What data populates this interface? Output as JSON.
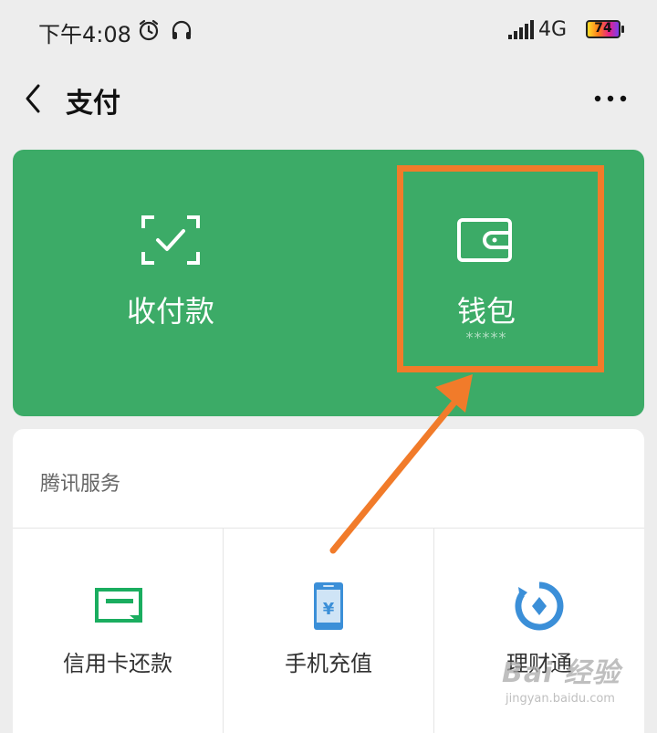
{
  "status_bar": {
    "time": "下午4:08",
    "network": "4G",
    "battery_level": "74",
    "icons": [
      "alarm-icon",
      "headset-icon",
      "signal-icon",
      "battery-icon"
    ]
  },
  "nav": {
    "title": "支付",
    "back_icon": "chevron-left-icon",
    "more_icon": "more-dots-icon"
  },
  "card": {
    "items": [
      {
        "label": "收付款",
        "icon": "scan-check-icon"
      },
      {
        "label": "钱包",
        "sub": "*****",
        "icon": "wallet-icon"
      }
    ],
    "color": "#3cab67"
  },
  "annotation": {
    "highlight_color": "#f17b2a"
  },
  "services": {
    "heading": "腾讯服务",
    "items": [
      {
        "label": "信用卡还款",
        "icon": "credit-card-icon",
        "color": "#1aad5f"
      },
      {
        "label": "手机充值",
        "icon": "phone-recharge-icon",
        "color": "#3b8fd8"
      },
      {
        "label": "理财通",
        "icon": "wealth-icon",
        "color": "#3b8fd8"
      }
    ]
  },
  "watermark": {
    "main": "Bai 经验",
    "sub": "jingyan.baidu.com"
  }
}
